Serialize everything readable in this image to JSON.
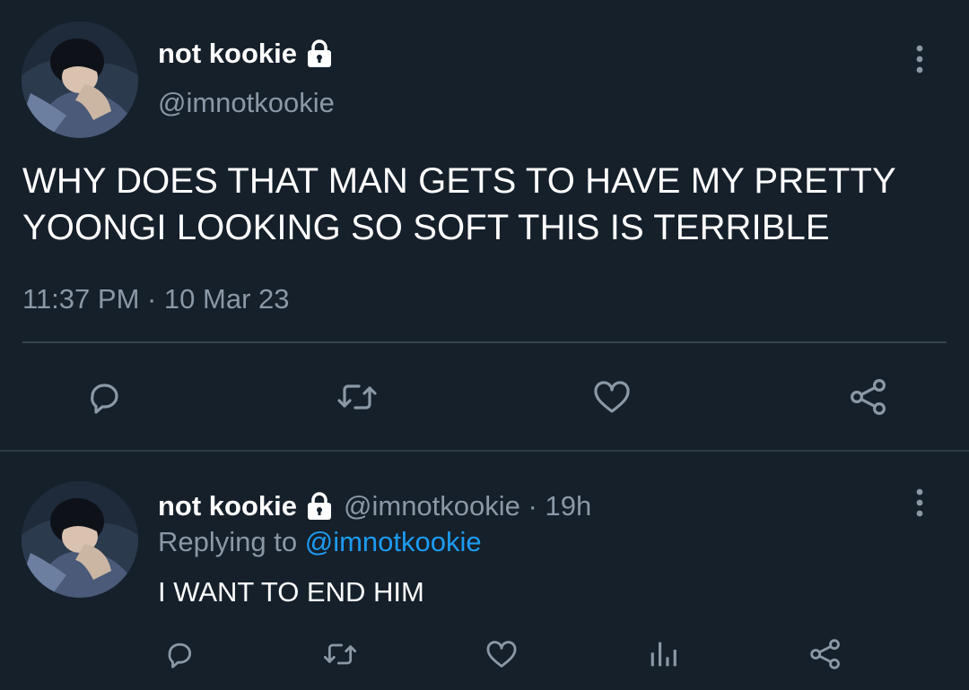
{
  "main_tweet": {
    "display_name": "not kookie",
    "handle": "@imnotkookie",
    "text": "WHY DOES THAT MAN GETS TO HAVE MY PRETTY YOONGI LOOKING SO SOFT THIS IS TERRIBLE",
    "timestamp": "11:37 PM · 10 Mar 23",
    "protected_icon": "lock-icon",
    "actions": [
      "reply-icon",
      "retweet-icon",
      "like-icon",
      "share-icon"
    ]
  },
  "reply_tweet": {
    "display_name": "not kookie",
    "handle": "@imnotkookie",
    "separator": " · ",
    "time_ago": "19h",
    "replying_prefix": "Replying to",
    "replying_to": "@imnotkookie",
    "text": "I WANT TO END HIM",
    "protected_icon": "lock-icon",
    "actions": [
      "reply-icon",
      "retweet-icon",
      "like-icon",
      "analytics-icon",
      "share-icon"
    ]
  },
  "colors": {
    "background": "#15202b",
    "primary_text": "#ffffff",
    "secondary_text": "#8b98a5",
    "accent": "#1d9bf0",
    "divider": "#38444d"
  }
}
